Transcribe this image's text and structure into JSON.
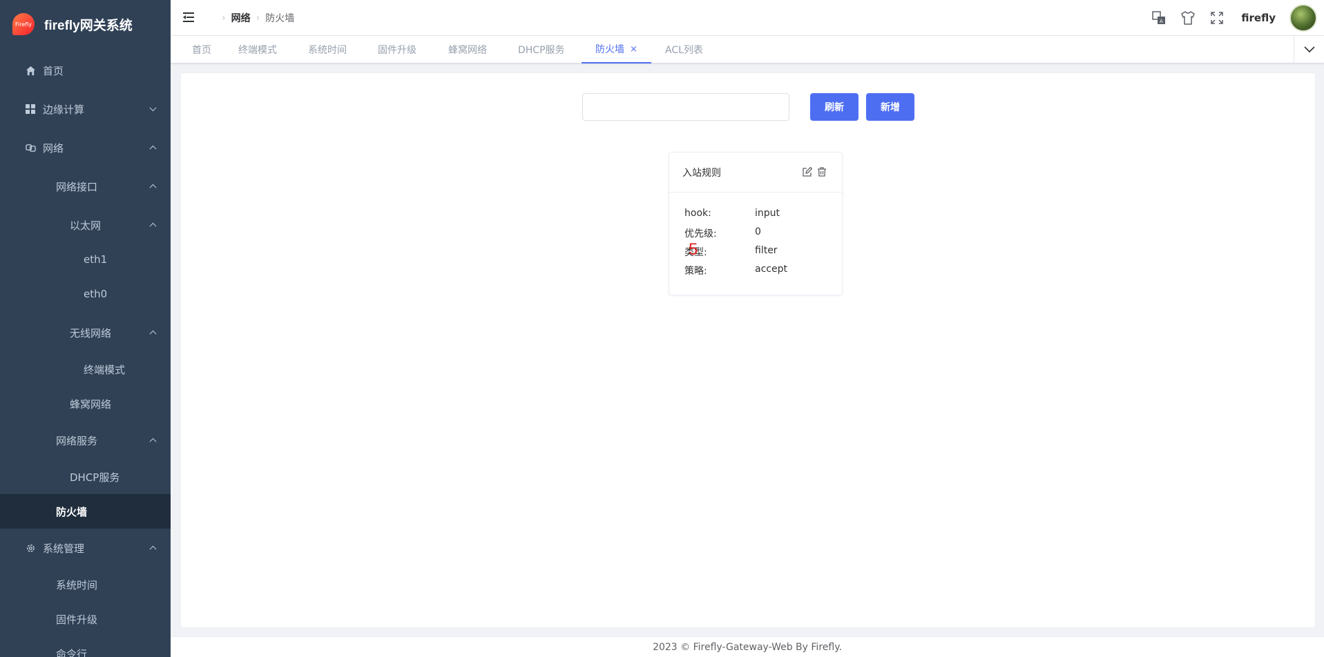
{
  "app": {
    "title": "firefly网关系统",
    "logo_text": "Firefly"
  },
  "sidebar": {
    "items": [
      {
        "label": "首页",
        "icon": "home-icon"
      },
      {
        "label": "边缘计算",
        "icon": "grid-icon"
      },
      {
        "label": "网络",
        "icon": "link-icon"
      },
      {
        "label": "网络接口"
      },
      {
        "label": "以太网"
      },
      {
        "label": "eth1"
      },
      {
        "label": "eth0"
      },
      {
        "label": "无线网络"
      },
      {
        "label": "终端模式"
      },
      {
        "label": "蜂窝网络"
      },
      {
        "label": "网络服务"
      },
      {
        "label": "DHCP服务"
      },
      {
        "label": "防火墙"
      },
      {
        "label": "系统管理",
        "icon": "gear-icon"
      },
      {
        "label": "系统时间"
      },
      {
        "label": "固件升级"
      },
      {
        "label": "命令行"
      }
    ]
  },
  "breadcrumb": {
    "parent": "网络",
    "current": "防火墙"
  },
  "header": {
    "username": "firefly"
  },
  "tags": [
    {
      "label": "首页"
    },
    {
      "label": "终端模式"
    },
    {
      "label": "系统时间"
    },
    {
      "label": "固件升级"
    },
    {
      "label": "蜂窝网络"
    },
    {
      "label": "DHCP服务"
    },
    {
      "label": "防火墙",
      "close": "×"
    },
    {
      "label": "ACL列表"
    }
  ],
  "toolbar": {
    "search_value": "",
    "refresh_label": "刷新",
    "add_label": "新增"
  },
  "card": {
    "title": "入站规则",
    "rows": [
      {
        "key": "hook:",
        "value": "input"
      },
      {
        "key": "优先级:",
        "value": "0"
      },
      {
        "key": "类型:",
        "value": "filter"
      },
      {
        "key": "策略:",
        "value": "accept"
      }
    ],
    "marker": "5"
  },
  "colors": {
    "sidebar_bg": "#304156",
    "accent": "#4e6ef2"
  },
  "footer": {
    "text": "2023 © Firefly-Gateway-Web By Firefly."
  }
}
